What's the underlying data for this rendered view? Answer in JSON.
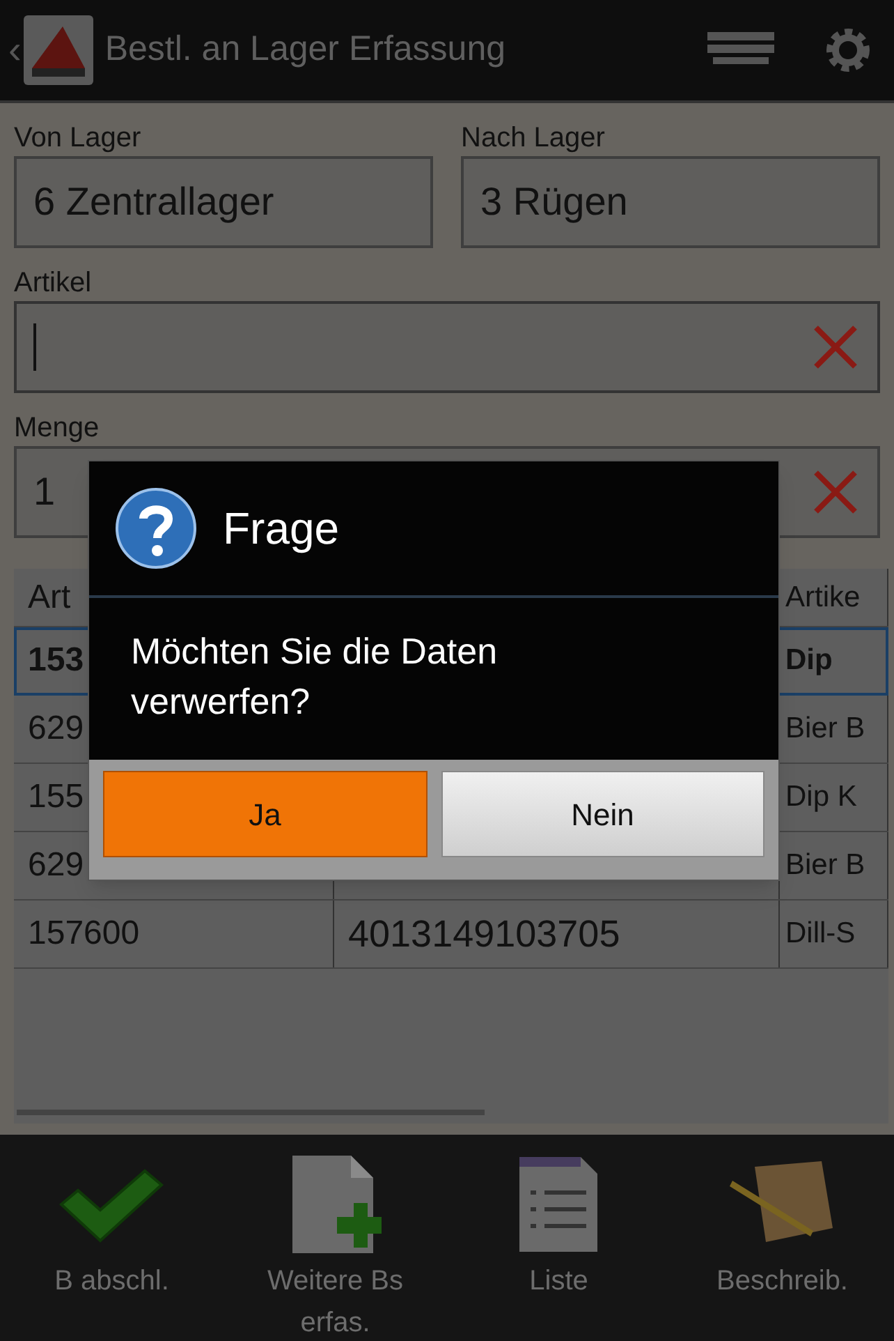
{
  "action_bar": {
    "back": "‹",
    "title": "Bestl. an Lager Erfassung"
  },
  "form": {
    "from": {
      "label": "Von Lager",
      "value": "6 Zentrallager"
    },
    "to": {
      "label": "Nach Lager",
      "value": "3 Rügen"
    },
    "article": {
      "label": "Artikel",
      "focused": true
    },
    "quantity": {
      "label": "Menge",
      "value": "1"
    }
  },
  "table": {
    "columns": [
      "Art",
      null,
      "Artike"
    ],
    "rows": [
      {
        "cells": [
          "153",
          null,
          "Dip"
        ],
        "selected": true
      },
      {
        "cells": [
          "629",
          null,
          "Bier B"
        ],
        "selected": false
      },
      {
        "cells": [
          "155",
          null,
          "Dip K"
        ],
        "selected": false
      },
      {
        "cells": [
          "629",
          null,
          "Bier B"
        ],
        "selected": false
      },
      {
        "cells": [
          "157600",
          "4013149103705",
          "Dill-S"
        ],
        "selected": false
      }
    ]
  },
  "dialog": {
    "title": "Frage",
    "message": "Möchten Sie die Daten verwerfen?",
    "buttons": [
      {
        "label": "Ja",
        "selected": true
      },
      {
        "label": "Nein",
        "selected": false
      }
    ]
  },
  "bottom_bar": [
    {
      "kind": "check",
      "label": "B abschl."
    },
    {
      "kind": "add",
      "label": "Weitere Bs erfas."
    },
    {
      "kind": "list",
      "label": "Liste"
    },
    {
      "kind": "notes",
      "label": "Beschreib."
    }
  ]
}
